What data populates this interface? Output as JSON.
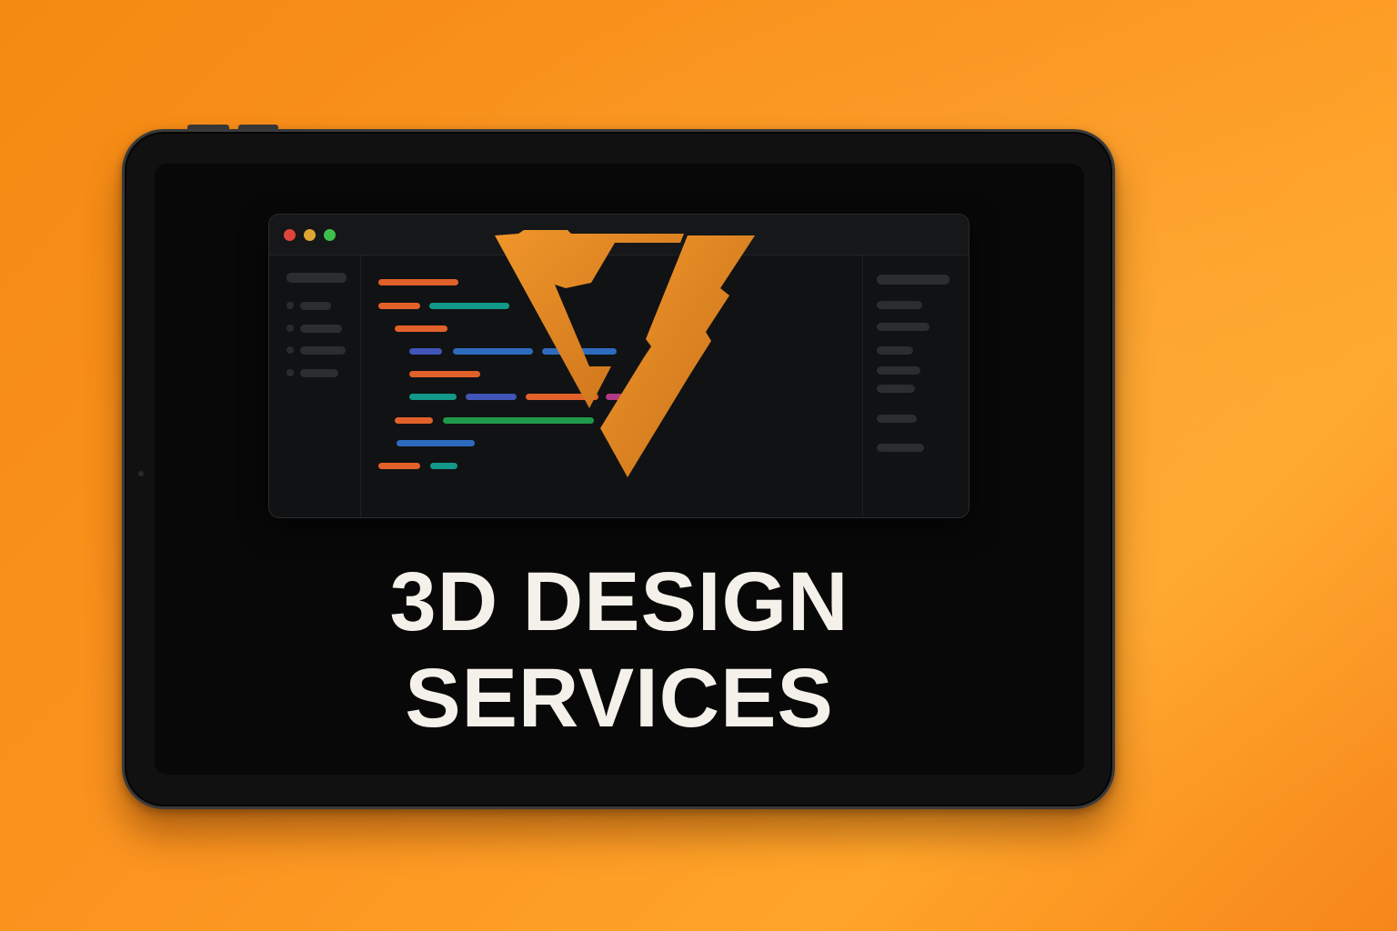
{
  "colors": {
    "background": "#f98f1c",
    "logo": "#e58b20",
    "headline": "#f4f1ea",
    "traffic_red": "#e0443a",
    "traffic_yellow": "#e0a634",
    "traffic_green": "#3fc04a",
    "code_orange": "#e2612a",
    "code_teal": "#12998a",
    "code_blue": "#2d6bbf",
    "code_indigo": "#4155b8",
    "code_green": "#1f9a4a",
    "code_magenta": "#b03a86"
  },
  "editor": {
    "window_controls": [
      "close-dot",
      "minimize-dot",
      "maximize-dot"
    ]
  },
  "logo": {
    "icon": "stylized-v-logo-icon"
  },
  "headline": {
    "line1": "3D DESIGN",
    "line2": "SERVICES"
  }
}
